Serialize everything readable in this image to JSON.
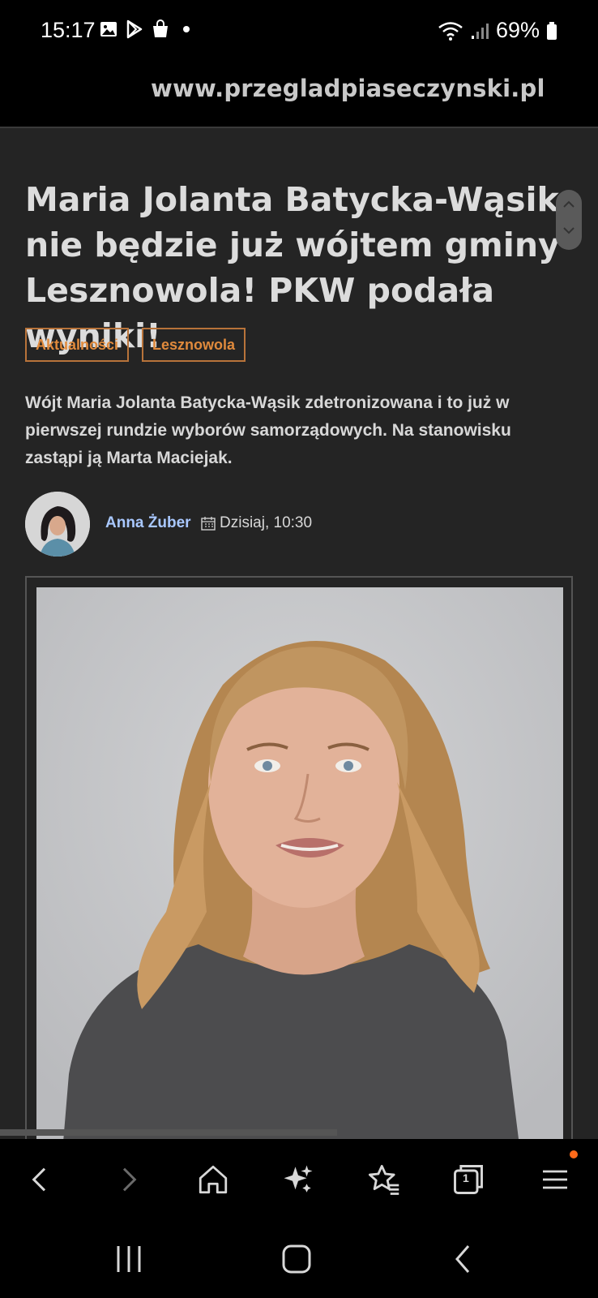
{
  "status": {
    "time": "15:17",
    "battery": "69%"
  },
  "browser": {
    "url": "www.przegladpiaseczynski.pl"
  },
  "article": {
    "headline": "Maria Jolanta Batycka-Wąsik nie będzie już wójtem gminy Lesznowola! PKW podała wyniki!",
    "tags": [
      "Aktualności",
      "Lesznowola"
    ],
    "lead": "Wójt Maria Jolanta Batycka-Wąsik zdetronizowana i to już w pierwszej rundzie wyborów samorządowych. Na stanowisku zastąpi ją Marta Maciejak.",
    "author": "Anna Żuber",
    "date": "Dzisiaj, 10:30"
  },
  "colors": {
    "accent": "#e08a3c",
    "author_link": "#a9c8ff",
    "background": "#242424",
    "notification_dot": "#ff6a1a"
  },
  "icons": [
    "image-icon",
    "play-store-icon",
    "shopping-bag-icon",
    "wifi-icon",
    "signal-icon",
    "battery-icon",
    "star-icon",
    "lock-icon",
    "reload-icon",
    "calendar-icon",
    "back-icon",
    "forward-icon",
    "home-icon",
    "sparkle-icon",
    "bookmarks-icon",
    "tabs-icon",
    "menu-icon"
  ],
  "tabs_count": "1"
}
